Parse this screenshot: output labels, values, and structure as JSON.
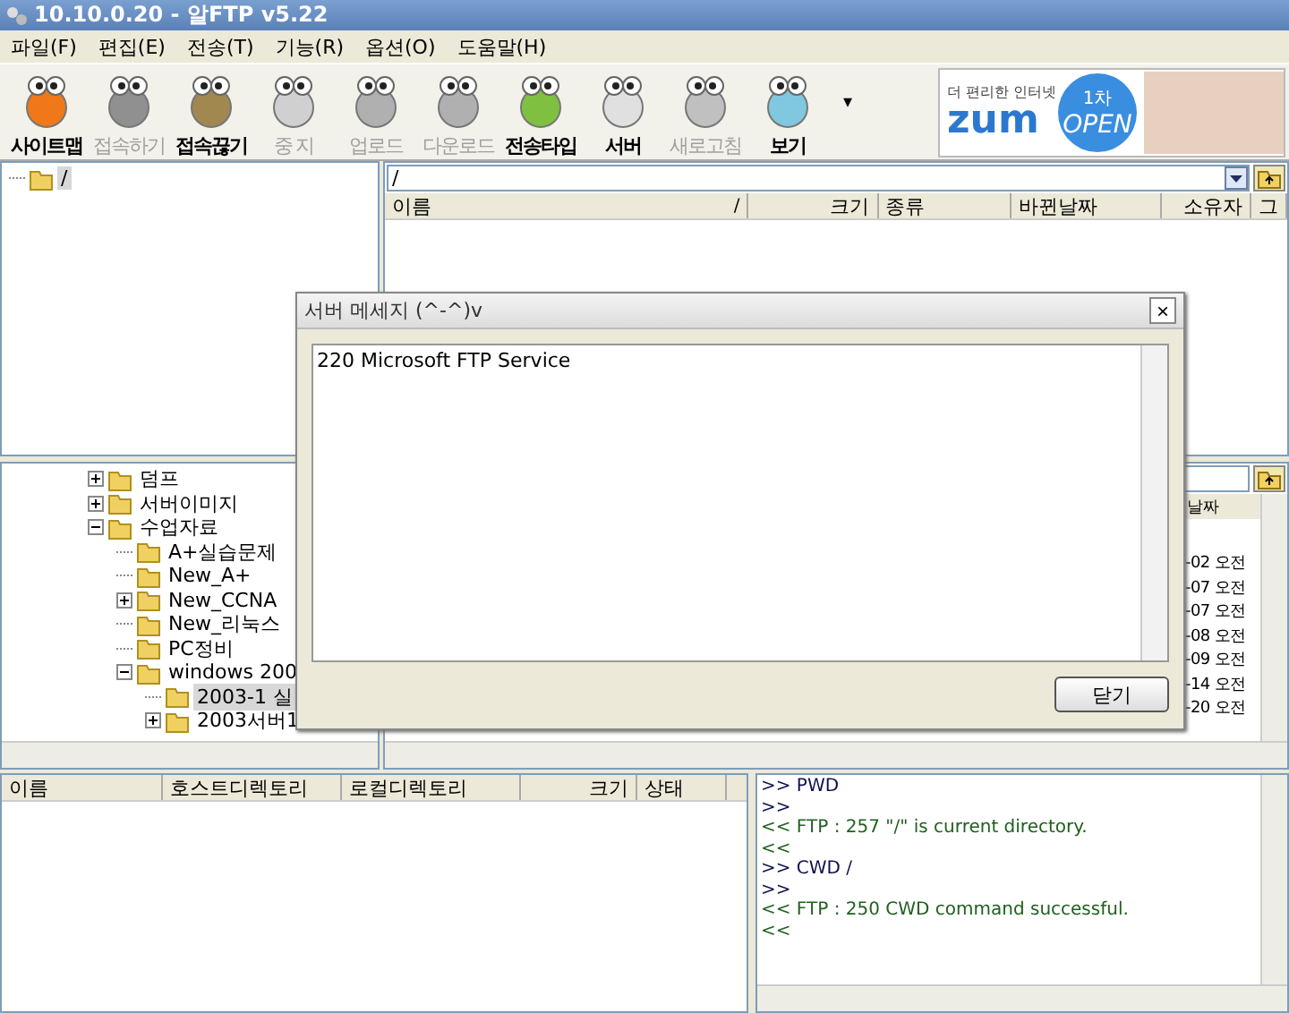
{
  "window": {
    "title": "10.10.0.20 - 알FTP v5.22"
  },
  "menu": [
    "파일(F)",
    "편집(E)",
    "전송(T)",
    "기능(R)",
    "옵션(O)",
    "도움말(H)"
  ],
  "toolbar": [
    {
      "label": "사이트맵",
      "disabled": false,
      "color": "#f07818"
    },
    {
      "label": "접속하기",
      "disabled": true,
      "color": "#909090"
    },
    {
      "label": "접속끊기",
      "disabled": false,
      "color": "#a08850"
    },
    {
      "label": "중 지",
      "disabled": true,
      "color": "#d0d0d0"
    },
    {
      "label": "업로드",
      "disabled": true,
      "color": "#b0b0b0"
    },
    {
      "label": "다운로드",
      "disabled": true,
      "color": "#b0b0b0"
    },
    {
      "label": "전송타입",
      "disabled": false,
      "color": "#80c040"
    },
    {
      "label": "서버",
      "disabled": false,
      "color": "#e0e0e0"
    },
    {
      "label": "새로고침",
      "disabled": true,
      "color": "#c0c0c0"
    },
    {
      "label": "보기",
      "disabled": false,
      "color": "#80c8e0"
    }
  ],
  "toolbar_more": "▾",
  "ad": {
    "tagline": "더 편리한 인터넷",
    "logo": "zum",
    "badge_top": "1차",
    "badge_main": "OPEN"
  },
  "local_tree_top": [
    {
      "label": "/",
      "kind": "leaf",
      "selected": true
    }
  ],
  "remote_top": {
    "path": "/",
    "columns": [
      "이름",
      "크기",
      "종류",
      "바뀐날짜",
      "소유자",
      "그"
    ],
    "sort_mark": "/"
  },
  "local_tree": [
    {
      "label": "덤프",
      "kind": "collapsed",
      "selected": false
    },
    {
      "label": "서버이미지",
      "kind": "collapsed",
      "selected": false
    },
    {
      "label": "수업자료",
      "kind": "expanded",
      "selected": false,
      "children": [
        {
          "label": "A+실습문제",
          "kind": "leaf",
          "selected": false
        },
        {
          "label": "New_A+",
          "kind": "leaf",
          "selected": false
        },
        {
          "label": "New_CCNA",
          "kind": "collapsed",
          "selected": false
        },
        {
          "label": "New_리눅스",
          "kind": "leaf",
          "selected": false
        },
        {
          "label": "PC정비",
          "kind": "leaf",
          "selected": false
        },
        {
          "label": "windows 200",
          "kind": "expanded",
          "selected": false,
          "children": [
            {
              "label": "2003-1 실",
              "kind": "leaf",
              "selected": true
            },
            {
              "label": "2003서버1",
              "kind": "collapsed",
              "selected": false
            }
          ]
        }
      ]
    }
  ],
  "remote_lower": {
    "column": "날짜",
    "rows": [
      "-02 오전",
      "-07 오전",
      "-07 오전",
      "-08 오전",
      "-09 오전",
      "-14 오전",
      "-20 오전"
    ]
  },
  "queue": {
    "columns": [
      "이름",
      "호스트디렉토리",
      "로컬디렉토리",
      "크기",
      "상태"
    ]
  },
  "log": [
    {
      "text": ">> PWD",
      "kind": "sent"
    },
    {
      "text": ">>",
      "kind": "sent"
    },
    {
      "text": "<< FTP : 257 \"/\" is current directory.",
      "kind": "received"
    },
    {
      "text": "<<",
      "kind": "received"
    },
    {
      "text": ">> CWD /",
      "kind": "sent"
    },
    {
      "text": ">>",
      "kind": "sent"
    },
    {
      "text": "<< FTP : 250 CWD command successful.",
      "kind": "received"
    },
    {
      "text": "<<",
      "kind": "received"
    }
  ],
  "dialog": {
    "title": "서버 메세지 (^-^)v",
    "close": "×",
    "message": "220 Microsoft FTP Service",
    "button": "닫기"
  }
}
